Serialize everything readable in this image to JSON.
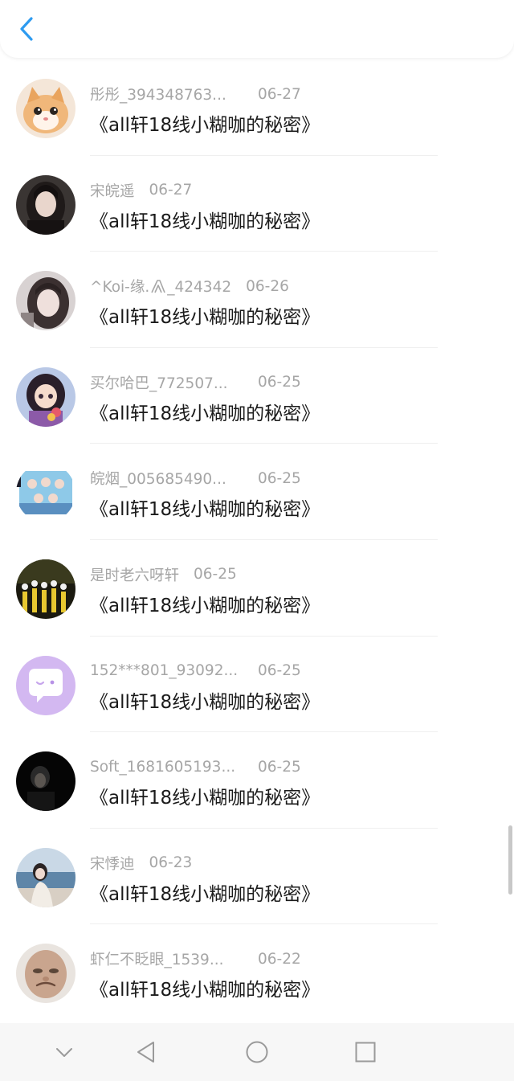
{
  "header": {
    "back_icon": "chevron-left-icon",
    "accent_color": "#2e9bf0"
  },
  "list": {
    "items": [
      {
        "name": "彤彤_394348763...",
        "date": "06-27",
        "title": "《all轩18线小糊咖的秘密》",
        "avatar": "orange-kitten"
      },
      {
        "name": "宋皖遥",
        "date": "06-27",
        "title": "《all轩18线小糊咖的秘密》",
        "avatar": "girl-dark-hair"
      },
      {
        "name": "^Koi-缘.",
        "name_tail": "_424342",
        "date": "06-26",
        "title": "《all轩18线小糊咖的秘密》",
        "avatar": "girl-selfie"
      },
      {
        "name": "买尔哈巴_772507...",
        "date": "06-25",
        "title": "《all轩18线小糊咖的秘密》",
        "avatar": "cartoon-girl-flowers"
      },
      {
        "name": "皖烟_005685490...",
        "date": "06-25",
        "title": "《all轩18线小糊咖的秘密》",
        "avatar": "group-photo-blue"
      },
      {
        "name": "是时老六呀轩",
        "date": "06-25",
        "title": "《all轩18线小糊咖的秘密》",
        "avatar": "stage-performers"
      },
      {
        "name": "152***801_93092...",
        "date": "06-25",
        "title": "《all轩18线小糊咖的秘密》",
        "avatar": "default-chat-bubble"
      },
      {
        "name": "Soft_1681605193...",
        "date": "06-25",
        "title": "《all轩18线小糊咖的秘密》",
        "avatar": "dark-portrait"
      },
      {
        "name": "宋悸迪",
        "date": "06-23",
        "title": "《all轩18线小糊咖的秘密》",
        "avatar": "girl-seaside"
      },
      {
        "name": "虾仁不眨眼_1539...",
        "date": "06-22",
        "title": "《all轩18线小糊咖的秘密》",
        "avatar": "meme-face"
      }
    ]
  },
  "nav_bar": {
    "icons": [
      "chevron-down-icon",
      "back-triangle-icon",
      "home-circle-icon",
      "recents-square-icon"
    ]
  }
}
